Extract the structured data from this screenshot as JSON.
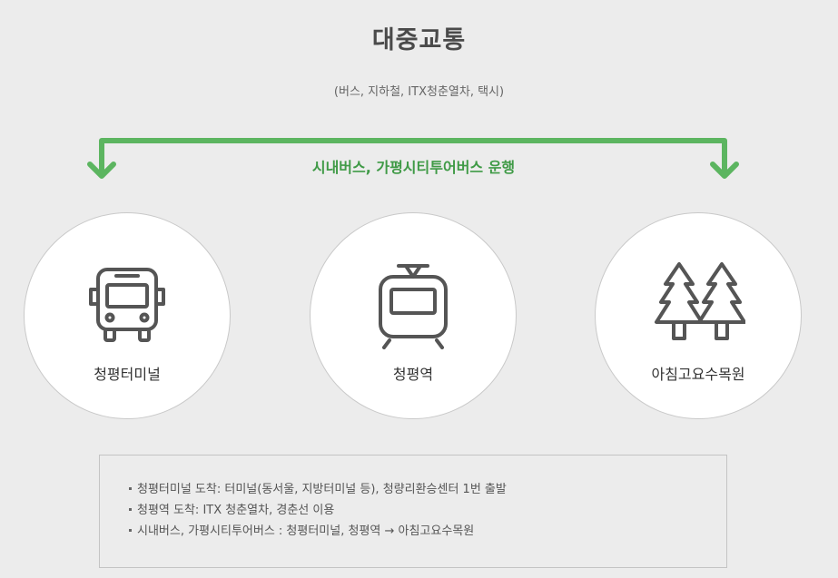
{
  "heading": {
    "title": "대중교통",
    "subtitle": "(버스, 지하철, ITX청춘열차, 택시)"
  },
  "route": {
    "label": "시내버스, 가평시티투어버스 운행",
    "color": "#5cb560"
  },
  "stops": [
    {
      "label": "청평터미널",
      "icon": "bus-icon"
    },
    {
      "label": "청평역",
      "icon": "train-icon"
    },
    {
      "label": "아침고요수목원",
      "icon": "trees-icon"
    }
  ],
  "info": {
    "items": [
      "청평터미널 도착: 터미널(동서울, 지방터미널 등), 청량리환승센터 1번 출발",
      "청평역 도착: ITX 청춘열차, 경춘선 이용",
      "시내버스, 가평시티투어버스 : 청평터미널, 청평역 → 아침고요수목원"
    ]
  }
}
